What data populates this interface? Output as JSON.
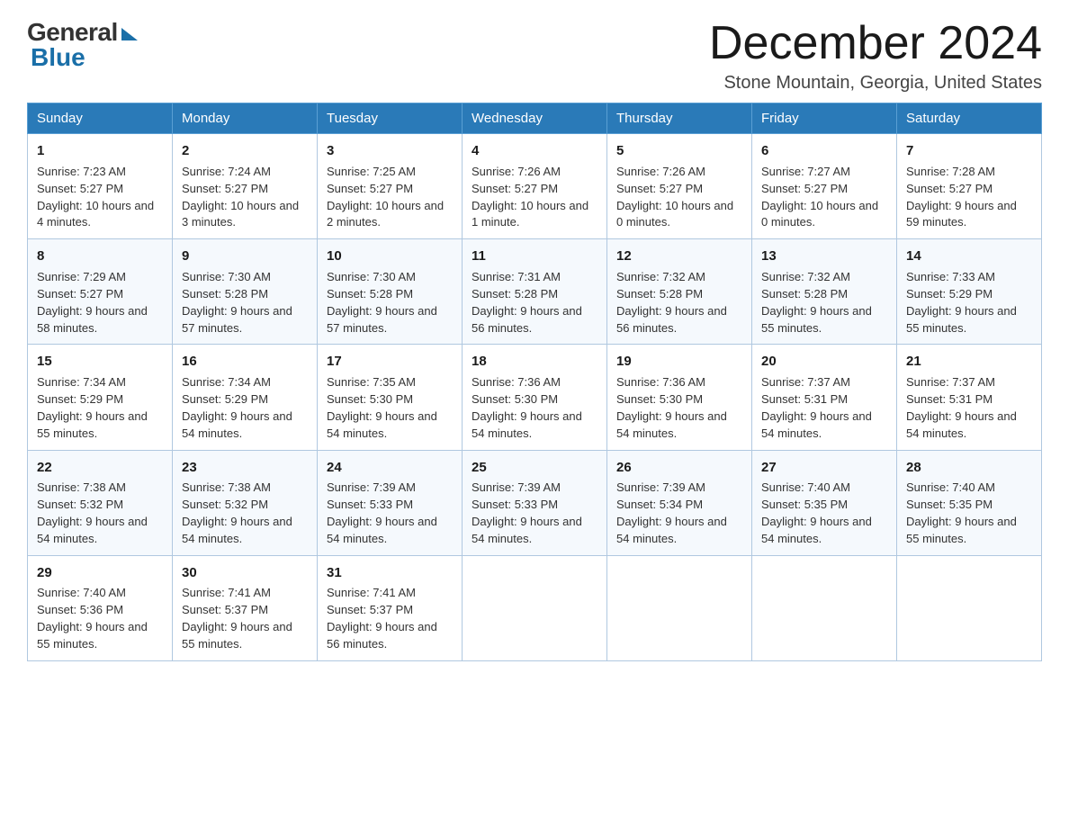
{
  "header": {
    "logo_general": "General",
    "logo_blue": "Blue",
    "month_year": "December 2024",
    "location": "Stone Mountain, Georgia, United States"
  },
  "days_of_week": [
    "Sunday",
    "Monday",
    "Tuesday",
    "Wednesday",
    "Thursday",
    "Friday",
    "Saturday"
  ],
  "weeks": [
    [
      {
        "day": "1",
        "sunrise": "7:23 AM",
        "sunset": "5:27 PM",
        "daylight": "10 hours and 4 minutes."
      },
      {
        "day": "2",
        "sunrise": "7:24 AM",
        "sunset": "5:27 PM",
        "daylight": "10 hours and 3 minutes."
      },
      {
        "day": "3",
        "sunrise": "7:25 AM",
        "sunset": "5:27 PM",
        "daylight": "10 hours and 2 minutes."
      },
      {
        "day": "4",
        "sunrise": "7:26 AM",
        "sunset": "5:27 PM",
        "daylight": "10 hours and 1 minute."
      },
      {
        "day": "5",
        "sunrise": "7:26 AM",
        "sunset": "5:27 PM",
        "daylight": "10 hours and 0 minutes."
      },
      {
        "day": "6",
        "sunrise": "7:27 AM",
        "sunset": "5:27 PM",
        "daylight": "10 hours and 0 minutes."
      },
      {
        "day": "7",
        "sunrise": "7:28 AM",
        "sunset": "5:27 PM",
        "daylight": "9 hours and 59 minutes."
      }
    ],
    [
      {
        "day": "8",
        "sunrise": "7:29 AM",
        "sunset": "5:27 PM",
        "daylight": "9 hours and 58 minutes."
      },
      {
        "day": "9",
        "sunrise": "7:30 AM",
        "sunset": "5:28 PM",
        "daylight": "9 hours and 57 minutes."
      },
      {
        "day": "10",
        "sunrise": "7:30 AM",
        "sunset": "5:28 PM",
        "daylight": "9 hours and 57 minutes."
      },
      {
        "day": "11",
        "sunrise": "7:31 AM",
        "sunset": "5:28 PM",
        "daylight": "9 hours and 56 minutes."
      },
      {
        "day": "12",
        "sunrise": "7:32 AM",
        "sunset": "5:28 PM",
        "daylight": "9 hours and 56 minutes."
      },
      {
        "day": "13",
        "sunrise": "7:32 AM",
        "sunset": "5:28 PM",
        "daylight": "9 hours and 55 minutes."
      },
      {
        "day": "14",
        "sunrise": "7:33 AM",
        "sunset": "5:29 PM",
        "daylight": "9 hours and 55 minutes."
      }
    ],
    [
      {
        "day": "15",
        "sunrise": "7:34 AM",
        "sunset": "5:29 PM",
        "daylight": "9 hours and 55 minutes."
      },
      {
        "day": "16",
        "sunrise": "7:34 AM",
        "sunset": "5:29 PM",
        "daylight": "9 hours and 54 minutes."
      },
      {
        "day": "17",
        "sunrise": "7:35 AM",
        "sunset": "5:30 PM",
        "daylight": "9 hours and 54 minutes."
      },
      {
        "day": "18",
        "sunrise": "7:36 AM",
        "sunset": "5:30 PM",
        "daylight": "9 hours and 54 minutes."
      },
      {
        "day": "19",
        "sunrise": "7:36 AM",
        "sunset": "5:30 PM",
        "daylight": "9 hours and 54 minutes."
      },
      {
        "day": "20",
        "sunrise": "7:37 AM",
        "sunset": "5:31 PM",
        "daylight": "9 hours and 54 minutes."
      },
      {
        "day": "21",
        "sunrise": "7:37 AM",
        "sunset": "5:31 PM",
        "daylight": "9 hours and 54 minutes."
      }
    ],
    [
      {
        "day": "22",
        "sunrise": "7:38 AM",
        "sunset": "5:32 PM",
        "daylight": "9 hours and 54 minutes."
      },
      {
        "day": "23",
        "sunrise": "7:38 AM",
        "sunset": "5:32 PM",
        "daylight": "9 hours and 54 minutes."
      },
      {
        "day": "24",
        "sunrise": "7:39 AM",
        "sunset": "5:33 PM",
        "daylight": "9 hours and 54 minutes."
      },
      {
        "day": "25",
        "sunrise": "7:39 AM",
        "sunset": "5:33 PM",
        "daylight": "9 hours and 54 minutes."
      },
      {
        "day": "26",
        "sunrise": "7:39 AM",
        "sunset": "5:34 PM",
        "daylight": "9 hours and 54 minutes."
      },
      {
        "day": "27",
        "sunrise": "7:40 AM",
        "sunset": "5:35 PM",
        "daylight": "9 hours and 54 minutes."
      },
      {
        "day": "28",
        "sunrise": "7:40 AM",
        "sunset": "5:35 PM",
        "daylight": "9 hours and 55 minutes."
      }
    ],
    [
      {
        "day": "29",
        "sunrise": "7:40 AM",
        "sunset": "5:36 PM",
        "daylight": "9 hours and 55 minutes."
      },
      {
        "day": "30",
        "sunrise": "7:41 AM",
        "sunset": "5:37 PM",
        "daylight": "9 hours and 55 minutes."
      },
      {
        "day": "31",
        "sunrise": "7:41 AM",
        "sunset": "5:37 PM",
        "daylight": "9 hours and 56 minutes."
      },
      null,
      null,
      null,
      null
    ]
  ]
}
